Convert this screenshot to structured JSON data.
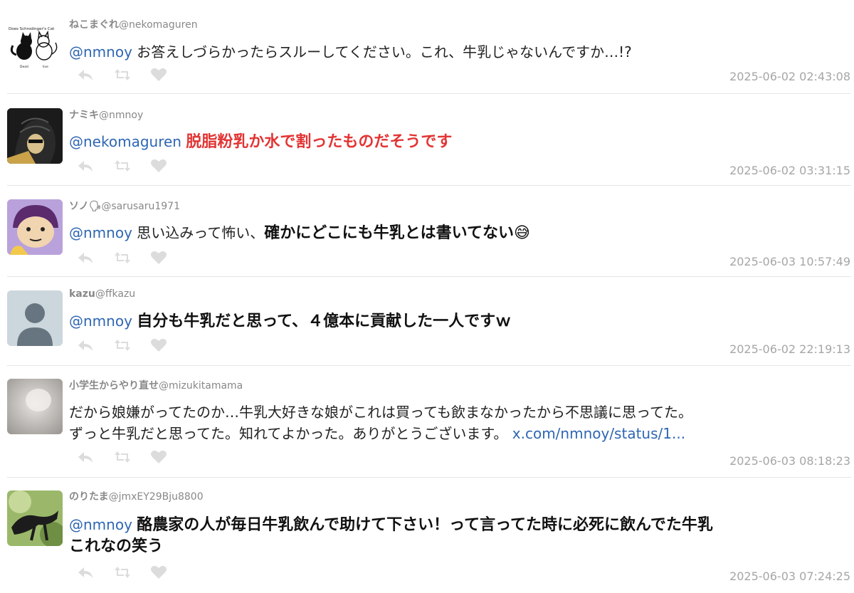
{
  "tweets": [
    {
      "name": "ねこまぐれ",
      "handle": "@nekomaguren",
      "mention": "@nmnoy",
      "text": "お答えしづらかったらスルーしてください。これ、牛乳じゃないんですか…!?",
      "timestamp": "2025-06-02 02:43:08",
      "avatar_caption": "Does Schrodinger's Cat",
      "avatar_label_left": "Dead",
      "avatar_label_right": "live"
    },
    {
      "name": "ナミキ",
      "handle": "@nmnoy",
      "mention": "@nekomaguren",
      "text": "脱脂粉乳か水で割ったものだそうです",
      "timestamp": "2025-06-02 03:31:15"
    },
    {
      "name": "ソノ🗣",
      "handle": "@sarusaru1971",
      "mention": "@nmnoy",
      "text_plain": "思い込みって怖い、",
      "text_bold": "確かにどこにも牛乳とは書いてない😅",
      "timestamp": "2025-06-03 10:57:49"
    },
    {
      "name": "kazu",
      "handle": "@ffkazu",
      "mention": "@nmnoy",
      "text": "自分も牛乳だと思って、４億本に貢献した一人ですｗ",
      "timestamp": "2025-06-02 22:19:13"
    },
    {
      "name": "小学生からやり直せ",
      "handle": "@mizukitamama",
      "line1": "だから娘嫌がってたのか…牛乳大好きな娘がこれは買っても飲まなかったから不思議に思ってた。",
      "line2": "ずっと牛乳だと思ってた。知れてよかった。ありがとうございます。",
      "link": "x.com/nmnoy/status/1...",
      "timestamp": "2025-06-03 08:18:23"
    },
    {
      "name": "のりたま",
      "handle": "@jmxEY29Bju8800",
      "mention": "@nmnoy",
      "line1": "酪農家の人が毎日牛乳飲んで助けて下さい！って言ってた時に必死に飲んでた牛乳",
      "line2": "これなの笑う",
      "timestamp": "2025-06-03 07:24:25"
    }
  ],
  "icons": {
    "reply": "reply-icon",
    "retweet": "retweet-icon",
    "like": "heart-icon"
  },
  "colors": {
    "mention": "#2f66b3",
    "highlight": "#e33434",
    "meta": "#a6a6a6",
    "action": "#dcdcdc"
  }
}
